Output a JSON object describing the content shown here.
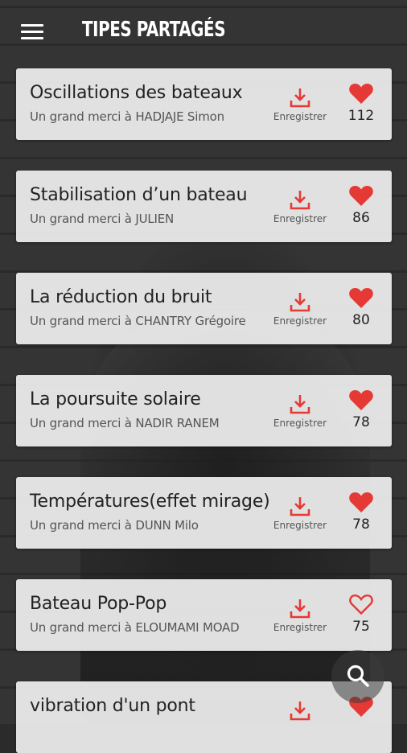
{
  "header": {
    "title": "TIPES PARTAGÉS",
    "menu_icon": "hamburger-menu-icon"
  },
  "cards": [
    {
      "title": "Oscillations des bateaux",
      "subtitle": "Un grand merci à HADJAJE Simon",
      "download_label": "Enregistrer",
      "likes": "112",
      "liked": true
    },
    {
      "title": "Stabilisation d’un bateau",
      "subtitle": "Un grand merci à JULIEN",
      "download_label": "Enregistrer",
      "likes": "86",
      "liked": true
    },
    {
      "title": "La réduction du bruit",
      "subtitle": "Un grand merci à CHANTRY Grégoire",
      "download_label": "Enregistrer",
      "likes": "80",
      "liked": true
    },
    {
      "title": "La poursuite solaire",
      "subtitle": "Un grand merci à NADIR RANEM",
      "download_label": "Enregistrer",
      "likes": "78",
      "liked": true
    },
    {
      "title": "Températures(effet mirage)",
      "subtitle": "Un grand merci à DUNN Milo",
      "download_label": "Enregistrer",
      "likes": "78",
      "liked": true
    },
    {
      "title": "Bateau Pop-Pop",
      "subtitle": "Un grand merci à ELOUMAMI MOAD",
      "download_label": "Enregistrer",
      "likes": "75",
      "liked": false
    },
    {
      "title": "vibration d'un pont",
      "subtitle": "",
      "download_label": "",
      "likes": "",
      "liked": true
    }
  ],
  "colors": {
    "accent": "#e53935",
    "card_bg": "#ececec",
    "text": "#222222"
  },
  "fab": {
    "icon": "search-icon"
  }
}
